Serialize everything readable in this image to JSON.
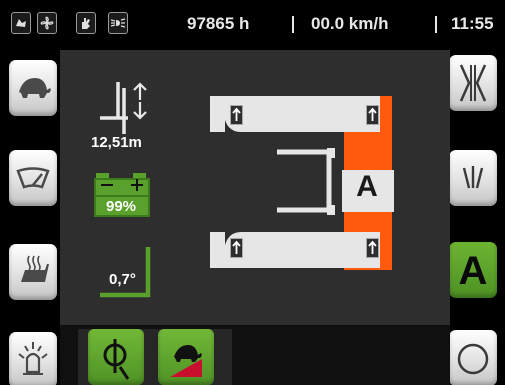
{
  "status_bar": {
    "icons": [
      "fan-speed-icon",
      "fan-icon",
      "hand-icon",
      "lights-icon"
    ],
    "hours": "97865 h",
    "speed": "00.0 km/h",
    "time": "11:55"
  },
  "left_buttons": [
    "turtle-speed-icon",
    "wiper-icon",
    "seat-heater-icon",
    "warning-beacon-icon"
  ],
  "right_buttons": [
    "fork-spread-icon",
    "wiper-interval-icon",
    "auto-mode-button",
    "circle-button"
  ],
  "auto_mode_label": "A",
  "main": {
    "lift_height": "12,51m",
    "battery_percent": "99%",
    "battery_level": 0.99,
    "tilt_angle": "0,7°",
    "side_shift_label": "A"
  },
  "bottom_buttons": [
    "fork-positioner-icon",
    "turtle-slope-icon"
  ],
  "colors": {
    "accent_green": "#5aa02c",
    "accent_orange": "#ff5a0e",
    "panel": "#2e2e2e"
  }
}
